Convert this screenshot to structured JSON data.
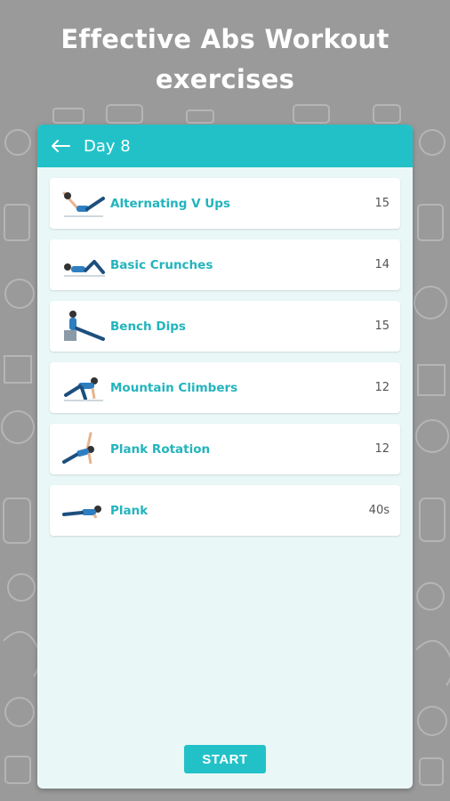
{
  "promo": {
    "title_line1": "Effective Abs Workout",
    "title_line2": "exercises"
  },
  "appbar": {
    "back_icon": "arrow-left-icon",
    "title": "Day 8"
  },
  "exercises": [
    {
      "name": "Alternating V Ups",
      "count": "15",
      "icon": "v-ups-illustration"
    },
    {
      "name": "Basic Crunches",
      "count": "14",
      "icon": "crunches-illustration"
    },
    {
      "name": "Bench Dips",
      "count": "15",
      "icon": "bench-dips-illustration"
    },
    {
      "name": "Mountain Climbers",
      "count": "12",
      "icon": "mountain-climbers-illustration"
    },
    {
      "name": "Plank Rotation",
      "count": "12",
      "icon": "plank-rotation-illustration"
    },
    {
      "name": "Plank",
      "count": "40s",
      "icon": "plank-illustration"
    }
  ],
  "start_label": "START",
  "colors": {
    "accent": "#22c1c8",
    "background": "#9a9a9a",
    "panel": "#e9f7f7"
  }
}
